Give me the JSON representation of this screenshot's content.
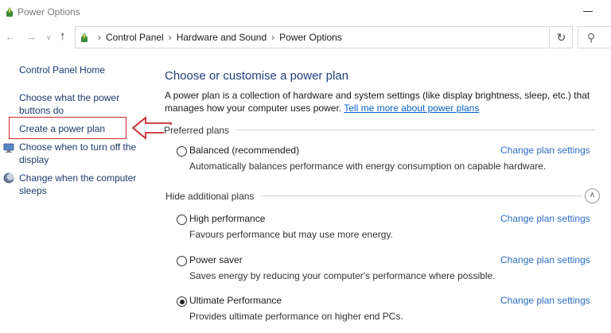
{
  "window": {
    "title": "Power Options"
  },
  "address": {
    "crumbs": [
      "Control Panel",
      "Hardware and Sound",
      "Power Options"
    ]
  },
  "sidebar": {
    "home": "Control Panel Home",
    "buttons": "Choose what the power buttons do",
    "create": "Create a power plan",
    "turnoff": "Choose when to turn off the display",
    "sleep": "Change when the computer sleeps"
  },
  "main": {
    "title": "Choose or customise a power plan",
    "desc": "A power plan is a collection of hardware and system settings (like display brightness, sleep, etc.) that manages how your computer uses power.",
    "desc_link": "Tell me more about power plans",
    "preferred_heading": "Preferred plans",
    "hidden_heading": "Hide additional plans",
    "change_label": "Change plan settings",
    "plans": [
      {
        "name": "Balanced (recommended)",
        "desc": "Automatically balances performance with energy consumption on capable hardware."
      },
      {
        "name": "High performance",
        "desc": "Favours performance but may use more energy."
      },
      {
        "name": "Power saver",
        "desc": "Saves energy by reducing your computer's performance where possible."
      },
      {
        "name": "Ultimate Performance",
        "desc": "Provides ultimate performance on higher end PCs."
      }
    ],
    "selected_plan": "Ultimate Performance"
  },
  "colors": {
    "link": "#2c6dc4",
    "title": "#1e3f7a",
    "annotation": "#c9282d"
  },
  "icons": {
    "app": "power-options-icon",
    "monitor": "monitor-icon",
    "moon": "moon-icon"
  }
}
